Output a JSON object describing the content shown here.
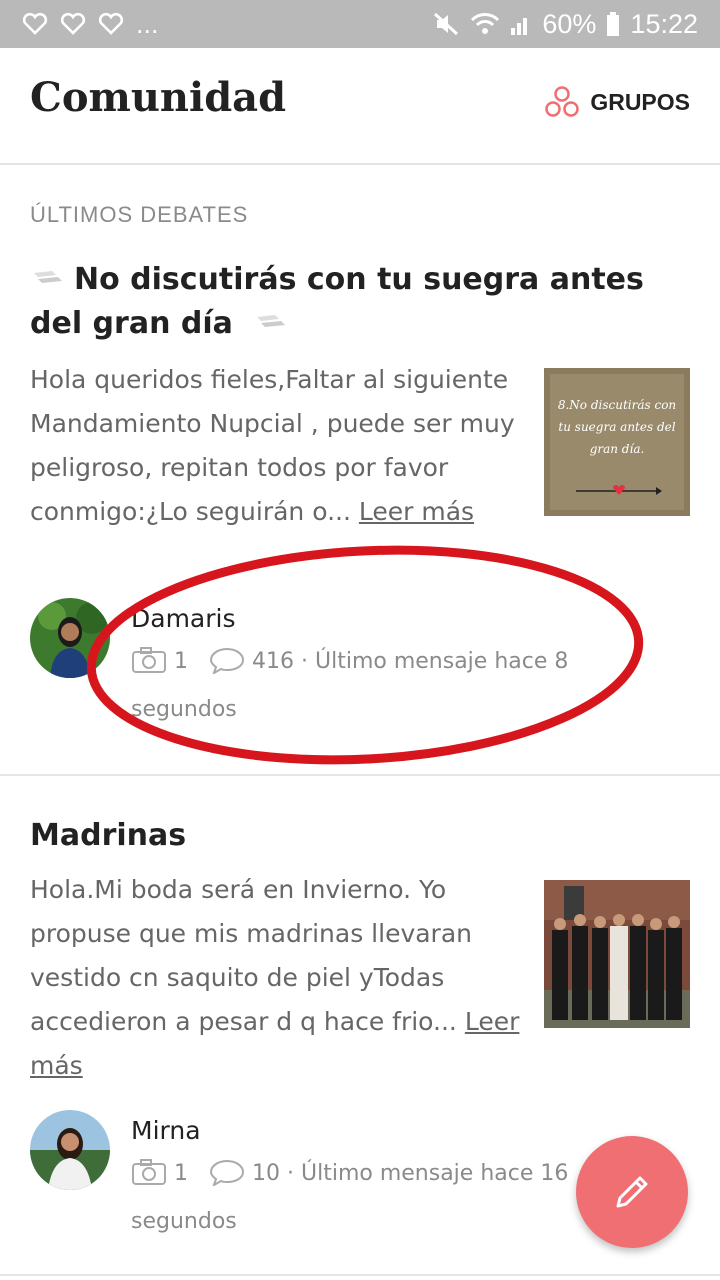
{
  "status_bar": {
    "ellipsis": "...",
    "battery": "60%",
    "time": "15:22"
  },
  "header": {
    "title": "Comunidad",
    "groups_label": "GRUPOS"
  },
  "section_label": "ÚLTIMOS DEBATES",
  "posts": [
    {
      "title": "No discutirás con tu suegra antes del gran día",
      "excerpt": "Hola queridos fieles,Faltar al siguiente Mandamiento Nupcial , puede ser muy peligroso, repitan todos por favor conmigo:¿Lo seguirán o...",
      "read_more": "Leer más",
      "thumbnail_text": "8.No discutirás con tu suegra antes del gran día.",
      "author": "Damaris",
      "photos": "1",
      "comments": "416",
      "last_message": "· Último mensaje hace 8 segundos"
    },
    {
      "title": "Madrinas",
      "excerpt": "Hola.Mi boda será en Invierno. Yo propuse que mis madrinas llevaran vestido cn saquito de piel yTodas accedieron a pesar d q hace frio...",
      "read_more": "Leer más",
      "author": "Mirna",
      "photos": "1",
      "comments": "10",
      "last_message": "· Último mensaje hace 16 segundos"
    }
  ],
  "colors": {
    "accent": "#ef6f73",
    "annotation": "#d7151c",
    "status_bar": "#b9b9b9"
  }
}
